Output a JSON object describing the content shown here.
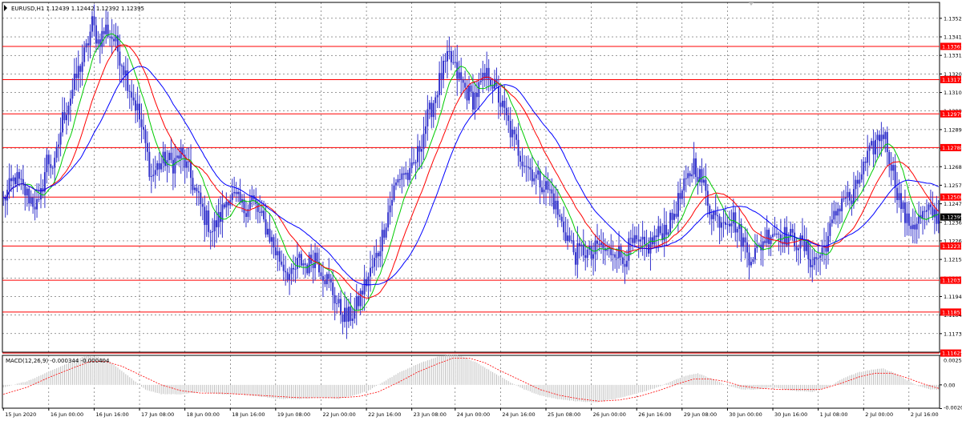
{
  "colors": {
    "background": "#ffffff",
    "frame": "#000000",
    "grid": "#000000",
    "candles": "#3333cc",
    "ma_fast": "#00cc00",
    "ma_mid": "#ff0000",
    "ma_slow": "#0000ff",
    "level_line": "#ff0000",
    "level_tag_bg": "#ff0000",
    "level_tag_text": "#ffffff",
    "price_tag_bg": "#000000",
    "price_tag_text": "#ffffff",
    "macd_hist": "#c0c0c0",
    "macd_signal": "#ff0000"
  },
  "icons": {
    "window_menu": "window-menu-icon",
    "scroll_marker": "scroll-marker-icon"
  },
  "chart_data": [
    {
      "type": "candlestick",
      "symbol_info": "EURUSD,H1  1.12439 1.12442 1.12392 1.12395",
      "ylim": [
        1.1163,
        1.1361
      ],
      "y_ticks": [
        "1.13520",
        "1.13415",
        "1.13310",
        "1.13205",
        "1.13100",
        "1.12995",
        "1.12890",
        "1.12785",
        "1.12680",
        "1.12575",
        "1.12470",
        "1.12365",
        "1.12260",
        "1.12155",
        "1.12050",
        "1.11945",
        "1.11840",
        "1.11735",
        "1.11630"
      ],
      "current_price": "1.12395",
      "x_labels": [
        "15 Jun 2020",
        "16 Jun 00:00",
        "16 Jun 16:00",
        "17 Jun 08:00",
        "18 Jun 00:00",
        "18 Jun 16:00",
        "19 Jun 08:00",
        "22 Jun 00:00",
        "22 Jun 16:00",
        "23 Jun 08:00",
        "24 Jun 00:00",
        "24 Jun 16:00",
        "25 Jun 08:00",
        "26 Jun 00:00",
        "26 Jun 16:00",
        "29 Jun 08:00",
        "30 Jun 00:00",
        "30 Jun 16:00",
        "1 Jul 08:00",
        "2 Jul 00:00",
        "2 Jul 16:00"
      ],
      "horizontal_levels": [
        "1.13361",
        "1.13173",
        "1.12979",
        "1.12788",
        "1.12508",
        "1.12231",
        "1.12037",
        "1.11857",
        "1.11625"
      ],
      "close_path": [
        [
          0,
          1.1249
        ],
        [
          6,
          1.1262
        ],
        [
          12,
          1.1252
        ],
        [
          18,
          1.1245
        ],
        [
          22,
          1.1272
        ],
        [
          26,
          1.1268
        ],
        [
          30,
          1.1295
        ],
        [
          34,
          1.1308
        ],
        [
          38,
          1.1322
        ],
        [
          42,
          1.1334
        ],
        [
          45,
          1.1349
        ],
        [
          48,
          1.1339
        ],
        [
          52,
          1.1346
        ],
        [
          56,
          1.134
        ],
        [
          60,
          1.1328
        ],
        [
          64,
          1.1313
        ],
        [
          68,
          1.13
        ],
        [
          72,
          1.128
        ],
        [
          75,
          1.1262
        ],
        [
          78,
          1.1268
        ],
        [
          82,
          1.1272
        ],
        [
          86,
          1.127
        ],
        [
          90,
          1.1275
        ],
        [
          94,
          1.1265
        ],
        [
          98,
          1.1252
        ],
        [
          102,
          1.124
        ],
        [
          106,
          1.1232
        ],
        [
          110,
          1.124
        ],
        [
          114,
          1.1252
        ],
        [
          118,
          1.1249
        ],
        [
          122,
          1.1244
        ],
        [
          126,
          1.125
        ],
        [
          130,
          1.124
        ],
        [
          134,
          1.1232
        ],
        [
          138,
          1.122
        ],
        [
          142,
          1.1212
        ],
        [
          146,
          1.1205
        ],
        [
          150,
          1.1215
        ],
        [
          154,
          1.1212
        ],
        [
          158,
          1.1218
        ],
        [
          162,
          1.1208
        ],
        [
          166,
          1.12
        ],
        [
          170,
          1.1188
        ],
        [
          174,
          1.1182
        ],
        [
          178,
          1.1186
        ],
        [
          182,
          1.1198
        ],
        [
          186,
          1.1208
        ],
        [
          190,
          1.122
        ],
        [
          194,
          1.1238
        ],
        [
          198,
          1.1255
        ],
        [
          202,
          1.1265
        ],
        [
          206,
          1.1262
        ],
        [
          210,
          1.1275
        ],
        [
          214,
          1.1292
        ],
        [
          218,
          1.1305
        ],
        [
          222,
          1.132
        ],
        [
          226,
          1.133
        ],
        [
          230,
          1.132
        ],
        [
          234,
          1.1312
        ],
        [
          238,
          1.1306
        ],
        [
          242,
          1.1314
        ],
        [
          246,
          1.1321
        ],
        [
          250,
          1.131
        ],
        [
          254,
          1.1298
        ],
        [
          258,
          1.1285
        ],
        [
          262,
          1.1275
        ],
        [
          266,
          1.1268
        ],
        [
          270,
          1.1262
        ],
        [
          274,
          1.1258
        ],
        [
          278,
          1.1252
        ],
        [
          282,
          1.1238
        ],
        [
          286,
          1.1228
        ],
        [
          290,
          1.1218
        ],
        [
          294,
          1.1221
        ],
        [
          298,
          1.1217
        ],
        [
          302,
          1.1224
        ],
        [
          306,
          1.1219
        ],
        [
          310,
          1.1222
        ],
        [
          314,
          1.1215
        ],
        [
          318,
          1.1224
        ],
        [
          322,
          1.1223
        ],
        [
          326,
          1.1222
        ],
        [
          330,
          1.1227
        ],
        [
          334,
          1.1232
        ],
        [
          338,
          1.1236
        ],
        [
          342,
          1.1248
        ],
        [
          346,
          1.1258
        ],
        [
          350,
          1.127
        ],
        [
          354,
          1.126
        ],
        [
          358,
          1.1245
        ],
        [
          362,
          1.1238
        ],
        [
          366,
          1.124
        ],
        [
          370,
          1.1238
        ],
        [
          374,
          1.1228
        ],
        [
          378,
          1.1218
        ],
        [
          382,
          1.122
        ],
        [
          386,
          1.1228
        ],
        [
          390,
          1.1232
        ],
        [
          394,
          1.123
        ],
        [
          398,
          1.1228
        ],
        [
          402,
          1.1226
        ],
        [
          406,
          1.1222
        ],
        [
          410,
          1.1214
        ],
        [
          414,
          1.1218
        ],
        [
          418,
          1.1228
        ],
        [
          422,
          1.1242
        ],
        [
          426,
          1.1252
        ],
        [
          430,
          1.1248
        ],
        [
          434,
          1.1262
        ],
        [
          438,
          1.1272
        ],
        [
          442,
          1.1282
        ],
        [
          446,
          1.1288
        ],
        [
          450,
          1.127
        ],
        [
          454,
          1.125
        ],
        [
          458,
          1.1236
        ],
        [
          462,
          1.1236
        ],
        [
          466,
          1.124
        ],
        [
          470,
          1.1242
        ],
        [
          474,
          1.124
        ]
      ],
      "series": [
        {
          "name": "",
          "kind": "ma_fast"
        },
        {
          "name": "",
          "kind": "ma_mid"
        },
        {
          "name": "",
          "kind": "ma_slow"
        }
      ]
    },
    {
      "type": "macd",
      "label": "MACD(12,26,9) -0.000344 -0.000404",
      "ylim": [
        -0.002,
        0.00253
      ],
      "y_ticks": [
        "0.00253",
        "0.00",
        "-0.00203"
      ],
      "histogram": [
        [
          0,
          -0.0002
        ],
        [
          12,
          0.0003
        ],
        [
          24,
          0.0012
        ],
        [
          36,
          0.0021
        ],
        [
          42,
          0.0025
        ],
        [
          48,
          0.0024
        ],
        [
          54,
          0.002
        ],
        [
          60,
          0.0012
        ],
        [
          66,
          0.0004
        ],
        [
          72,
          -0.0004
        ],
        [
          80,
          -0.0008
        ],
        [
          90,
          -0.0008
        ],
        [
          100,
          -0.0006
        ],
        [
          110,
          -0.0008
        ],
        [
          120,
          -0.0008
        ],
        [
          130,
          -0.001
        ],
        [
          140,
          -0.0012
        ],
        [
          150,
          -0.0012
        ],
        [
          160,
          -0.0011
        ],
        [
          170,
          -0.0012
        ],
        [
          180,
          -0.0008
        ],
        [
          186,
          -0.0004
        ],
        [
          192,
          0.0002
        ],
        [
          200,
          0.001
        ],
        [
          210,
          0.0018
        ],
        [
          220,
          0.0024
        ],
        [
          226,
          0.0026
        ],
        [
          232,
          0.0025
        ],
        [
          240,
          0.0019
        ],
        [
          248,
          0.0011
        ],
        [
          256,
          0.0003
        ],
        [
          264,
          -0.0004
        ],
        [
          272,
          -0.0009
        ],
        [
          280,
          -0.0012
        ],
        [
          290,
          -0.0014
        ],
        [
          300,
          -0.0015
        ],
        [
          310,
          -0.0012
        ],
        [
          320,
          -0.0008
        ],
        [
          330,
          -0.0003
        ],
        [
          340,
          0.0004
        ],
        [
          346,
          0.0008
        ],
        [
          352,
          0.001
        ],
        [
          358,
          0.0006
        ],
        [
          366,
          0.0
        ],
        [
          374,
          -0.0004
        ],
        [
          382,
          -0.0004
        ],
        [
          390,
          -0.0002
        ],
        [
          400,
          -0.0005
        ],
        [
          410,
          -0.0006
        ],
        [
          418,
          -0.0002
        ],
        [
          426,
          0.0006
        ],
        [
          434,
          0.0011
        ],
        [
          440,
          0.0013
        ],
        [
          446,
          0.0014
        ],
        [
          452,
          0.001
        ],
        [
          458,
          0.0004
        ],
        [
          464,
          -0.0001
        ],
        [
          470,
          -0.0004
        ],
        [
          474,
          -0.0004
        ]
      ],
      "signal": [
        [
          0,
          -0.0008
        ],
        [
          12,
          -0.0002
        ],
        [
          24,
          0.0007
        ],
        [
          36,
          0.0015
        ],
        [
          44,
          0.002
        ],
        [
          52,
          0.002
        ],
        [
          60,
          0.0016
        ],
        [
          70,
          0.0008
        ],
        [
          80,
          0.0
        ],
        [
          90,
          -0.0005
        ],
        [
          100,
          -0.0007
        ],
        [
          110,
          -0.0007
        ],
        [
          120,
          -0.0008
        ],
        [
          130,
          -0.0009
        ],
        [
          140,
          -0.001
        ],
        [
          150,
          -0.0011
        ],
        [
          160,
          -0.0011
        ],
        [
          170,
          -0.0011
        ],
        [
          180,
          -0.001
        ],
        [
          190,
          -0.0006
        ],
        [
          200,
          0.0002
        ],
        [
          210,
          0.0011
        ],
        [
          220,
          0.0018
        ],
        [
          228,
          0.0023
        ],
        [
          236,
          0.0023
        ],
        [
          244,
          0.0019
        ],
        [
          252,
          0.0012
        ],
        [
          262,
          0.0004
        ],
        [
          272,
          -0.0004
        ],
        [
          282,
          -0.0009
        ],
        [
          292,
          -0.0012
        ],
        [
          302,
          -0.0014
        ],
        [
          312,
          -0.0013
        ],
        [
          322,
          -0.001
        ],
        [
          332,
          -0.0005
        ],
        [
          342,
          0.0001
        ],
        [
          350,
          0.0005
        ],
        [
          358,
          0.0005
        ],
        [
          366,
          0.0003
        ],
        [
          374,
          -0.0001
        ],
        [
          384,
          -0.0003
        ],
        [
          394,
          -0.0004
        ],
        [
          404,
          -0.0004
        ],
        [
          414,
          -0.0004
        ],
        [
          424,
          0.0001
        ],
        [
          434,
          0.0007
        ],
        [
          442,
          0.001
        ],
        [
          450,
          0.001
        ],
        [
          458,
          0.0006
        ],
        [
          466,
          0.0001
        ],
        [
          474,
          -0.0003
        ]
      ]
    }
  ]
}
